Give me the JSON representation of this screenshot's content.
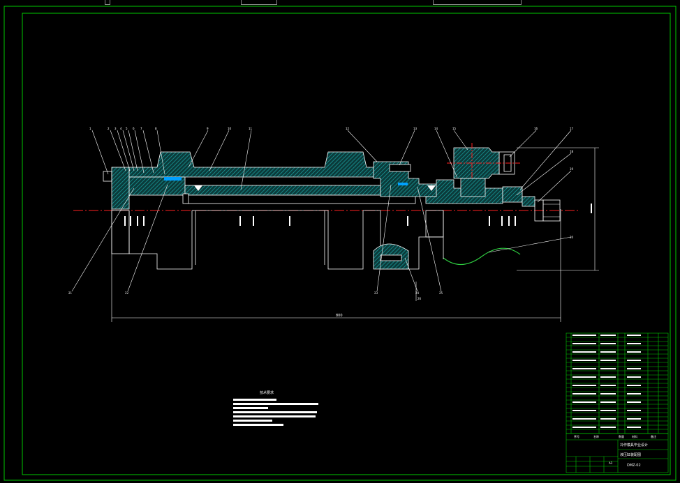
{
  "drawing": {
    "notes_title": "技术要求",
    "dimension_overall": "800",
    "title_block": {
      "name_line1": "冷作模具毕业设计",
      "name_line2": "液压缸装配图",
      "drawing_no": "DMZ-02",
      "sheet": "A1"
    },
    "bom_header": {
      "col_no": "序号",
      "col_name": "名称",
      "col_qty": "数量",
      "col_material": "材料",
      "col_note": "备注"
    },
    "balloons": [
      "1",
      "2",
      "3",
      "4",
      "5",
      "6",
      "7",
      "8",
      "9",
      "10",
      "11",
      "12",
      "13",
      "14",
      "15",
      "16",
      "17",
      "18",
      "19",
      "20",
      "21",
      "22",
      "23",
      "24",
      "25",
      "26"
    ]
  },
  "colors": {
    "background": "#000000",
    "border": "#00c800",
    "line": "#ffffff",
    "center": "#ff2020",
    "hatch": "#1aa5a5",
    "wave": "#2ecc40"
  }
}
